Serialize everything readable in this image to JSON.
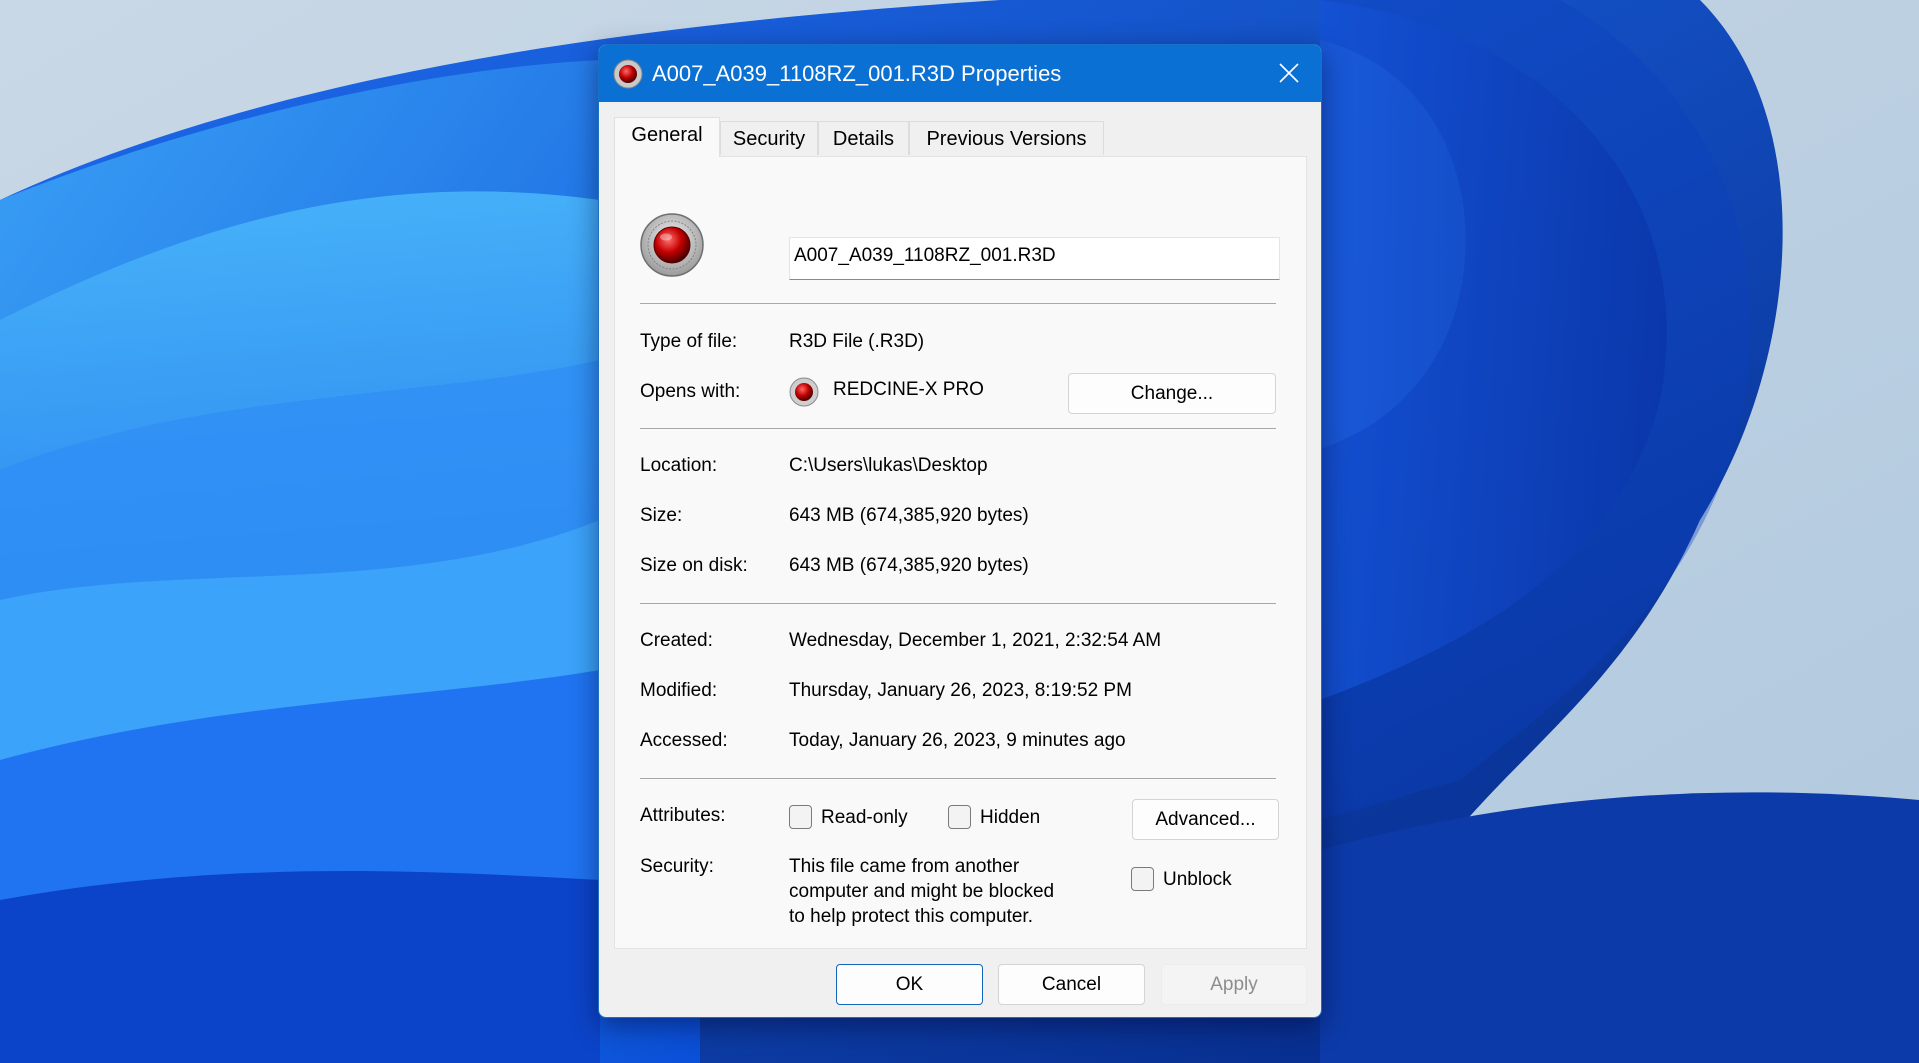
{
  "window": {
    "title": "A007_A039_1108RZ_001.R3D Properties",
    "title_icon": "redcine-app-icon",
    "close_icon": "close-icon",
    "titlebar_color": "#0b70d3"
  },
  "tabs": [
    {
      "label": "General",
      "active": true
    },
    {
      "label": "Security",
      "active": false
    },
    {
      "label": "Details",
      "active": false
    },
    {
      "label": "Previous Versions",
      "active": false
    }
  ],
  "general": {
    "file_icon": "redcine-file-icon",
    "file_name": "A007_A039_1108RZ_001.R3D",
    "type_of_file": {
      "label": "Type of file:",
      "value": "R3D File (.R3D)"
    },
    "opens_with": {
      "label": "Opens with:",
      "app_icon": "redcine-app-icon",
      "value": "REDCINE-X PRO",
      "change_button": "Change..."
    },
    "location": {
      "label": "Location:",
      "value": "C:\\Users\\lukas\\Desktop"
    },
    "size": {
      "label": "Size:",
      "value": "643 MB (674,385,920 bytes)"
    },
    "size_on_disk": {
      "label": "Size on disk:",
      "value": "643 MB (674,385,920 bytes)"
    },
    "created": {
      "label": "Created:",
      "value": "Wednesday, December 1, 2021, 2:32:54 AM"
    },
    "modified": {
      "label": "Modified:",
      "value": "Thursday, January 26, 2023, 8:19:52 PM"
    },
    "accessed": {
      "label": "Accessed:",
      "value": "Today, January 26, 2023, 9 minutes ago"
    },
    "attributes": {
      "label": "Attributes:",
      "read_only": {
        "label": "Read-only",
        "checked": false
      },
      "hidden": {
        "label": "Hidden",
        "checked": false
      },
      "advanced_button": "Advanced..."
    },
    "security": {
      "label": "Security:",
      "message": "This file came from another computer and might be blocked to help protect this computer.",
      "unblock": {
        "label": "Unblock",
        "checked": false
      }
    }
  },
  "footer": {
    "ok": "OK",
    "cancel": "Cancel",
    "apply": "Apply",
    "apply_enabled": false
  }
}
